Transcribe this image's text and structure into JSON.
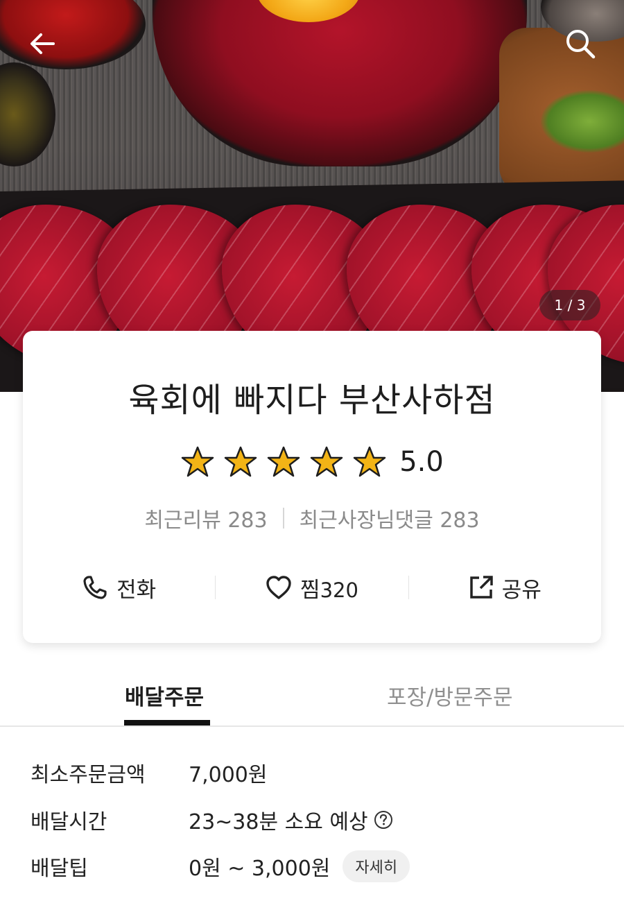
{
  "hero": {
    "page_counter": "1 / 3",
    "icons": {
      "back": "arrow-left-icon",
      "search": "search-icon"
    }
  },
  "store": {
    "name": "육회에 빠지다 부산사하점",
    "rating": "5.0",
    "stars": 5,
    "recent_reviews_label": "최근리뷰 283",
    "recent_owner_replies_label": "최근사장님댓글 283"
  },
  "actions": {
    "call": {
      "label": "전화",
      "icon": "phone-icon"
    },
    "favorite": {
      "label": "찜",
      "count": "320",
      "icon": "heart-icon"
    },
    "share": {
      "label": "공유",
      "icon": "share-icon"
    }
  },
  "tabs": {
    "delivery": "배달주문",
    "pickup": "포장/방문주문",
    "active": "delivery"
  },
  "delivery_info": {
    "min_order_label": "최소주문금액",
    "min_order_value": "7,000원",
    "time_label": "배달시간",
    "time_value": "23~38분 소요 예상",
    "tip_label": "배달팁",
    "tip_value": "0원 ~ 3,000원",
    "detail_button": "자세히"
  },
  "colors": {
    "star": "#f3b416",
    "text": "#222222",
    "muted": "#8a8a8a"
  }
}
